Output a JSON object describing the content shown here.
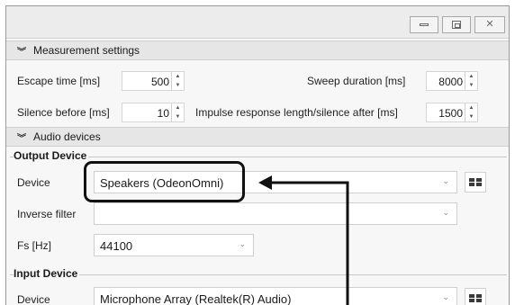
{
  "measurement": {
    "header": "Measurement settings",
    "escape_label": "Escape time [ms]",
    "escape_value": "500",
    "silence_label": "Silence before [ms]",
    "silence_value": "10",
    "sweep_label": "Sweep duration [ms]",
    "sweep_value": "8000",
    "impulse_label": "Impulse response length/silence after [ms]",
    "impulse_value": "1500"
  },
  "audio": {
    "header": "Audio devices",
    "output": {
      "title": "Output Device",
      "device_label": "Device",
      "device_value": "Speakers (OdeonOmni)",
      "inverse_label": "Inverse filter",
      "inverse_value": "",
      "fs_label": "Fs [Hz]",
      "fs_value": "44100"
    },
    "input": {
      "title": "Input Device",
      "device_label": "Device",
      "device_value": "Microphone Array (Realtek(R) Audio)"
    }
  },
  "icons": {
    "minimize": "minimize-icon",
    "maximize": "maximize-icon",
    "close": "close-icon",
    "collapse": "double-chevron-icon",
    "settings": "grid-icon",
    "dropdown": "chevron-down-icon",
    "callout_arrow": "arrow-left-icon"
  },
  "colors": {
    "header_bg": "#e6e6e6",
    "window_bg": "#f7f7f7",
    "callout": "#111111"
  }
}
